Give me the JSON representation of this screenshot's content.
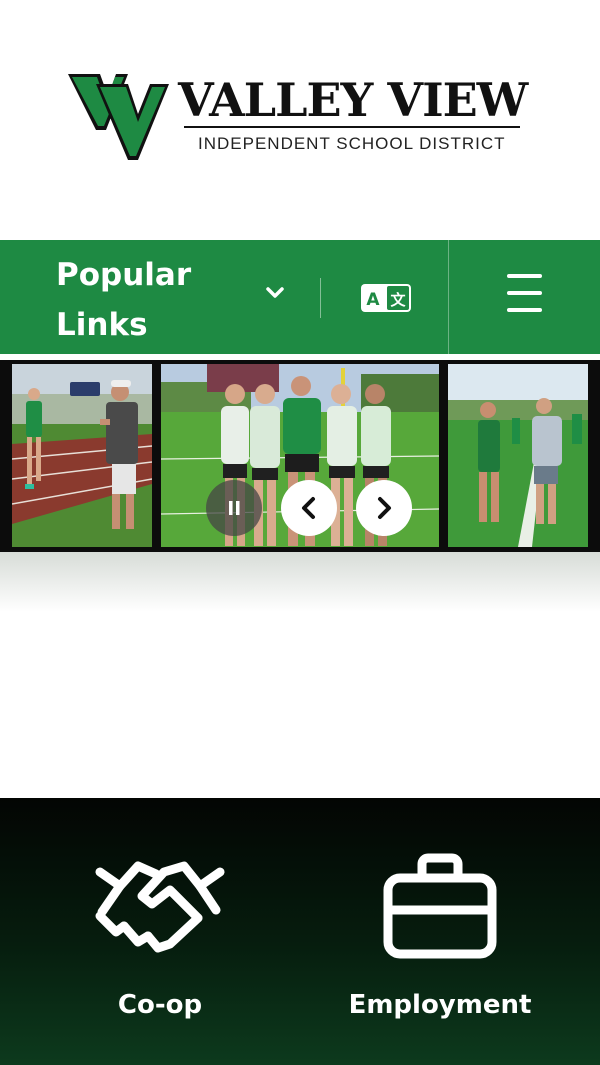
{
  "logo": {
    "title": "VALLEY VIEW",
    "subtitle": "INDEPENDENT SCHOOL DISTRICT",
    "colors": {
      "green": "#1e8a43",
      "black": "#111111"
    }
  },
  "navbar": {
    "popular_links_label": "Popular Links",
    "translate_icon": "translate-icon",
    "menu_icon": "hamburger-menu-icon",
    "background": "#1e8a43"
  },
  "carousel": {
    "slides": [
      {
        "name": "slide-track-runner-coach"
      },
      {
        "name": "slide-team-group-photo"
      },
      {
        "name": "slide-field-players"
      }
    ],
    "controls": {
      "pause_icon": "pause-icon",
      "prev_icon": "chevron-left-icon",
      "next_icon": "chevron-right-icon"
    }
  },
  "quick_links": [
    {
      "label": "Co-op",
      "icon": "handshake-icon"
    },
    {
      "label": "Employment",
      "icon": "briefcase-icon"
    }
  ]
}
